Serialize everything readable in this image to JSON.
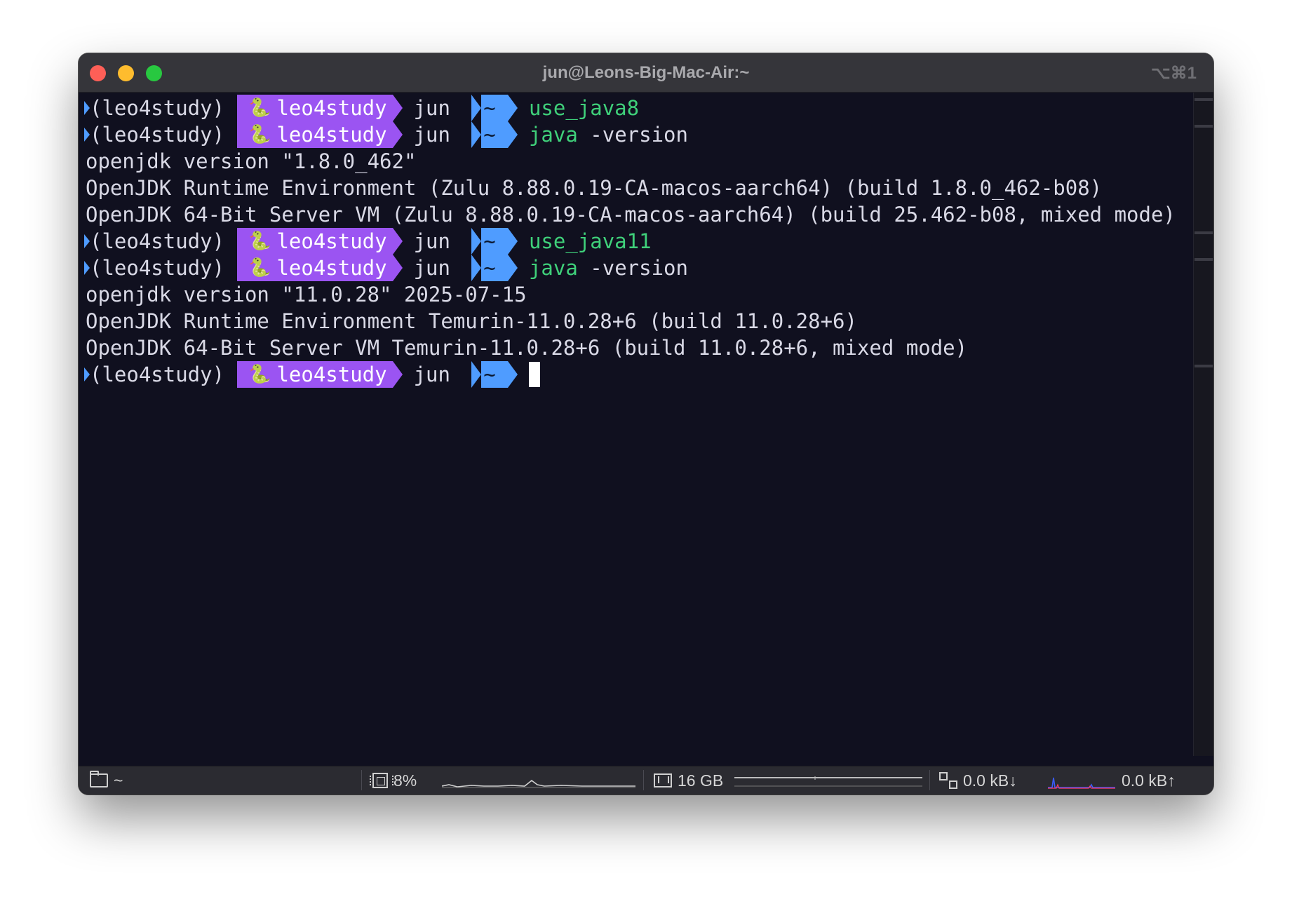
{
  "window": {
    "title": "jun@Leons-Big-Mac-Air:~",
    "shortcut": "⌥⌘1"
  },
  "prompt": {
    "env": "(leo4study)",
    "env_segment": "leo4study",
    "host": "jun",
    "dir": "~"
  },
  "terminal": {
    "lines": [
      {
        "type": "prompt",
        "cmd": "use_java8",
        "args": ""
      },
      {
        "type": "prompt",
        "cmd": "java",
        "args": " -version"
      },
      {
        "type": "output",
        "text": "openjdk version \"1.8.0_462\""
      },
      {
        "type": "output",
        "text": "OpenJDK Runtime Environment (Zulu 8.88.0.19-CA-macos-aarch64) (build 1.8.0_462-b08)"
      },
      {
        "type": "output",
        "text": "OpenJDK 64-Bit Server VM (Zulu 8.88.0.19-CA-macos-aarch64) (build 25.462-b08, mixed mode)"
      },
      {
        "type": "prompt",
        "cmd": "use_java11",
        "args": ""
      },
      {
        "type": "prompt",
        "cmd": "java",
        "args": " -version"
      },
      {
        "type": "output",
        "text": "openjdk version \"11.0.28\" 2025-07-15"
      },
      {
        "type": "output",
        "text": "OpenJDK Runtime Environment Temurin-11.0.28+6 (build 11.0.28+6)"
      },
      {
        "type": "output",
        "text": "OpenJDK 64-Bit Server VM Temurin-11.0.28+6 (build 11.0.28+6, mixed mode)"
      },
      {
        "type": "prompt_cursor",
        "cmd": "",
        "args": ""
      }
    ]
  },
  "statusbar": {
    "dir": "~",
    "cpu": "8%",
    "memory": "16 GB",
    "net_down": "0.0 kB↓",
    "net_up": "0.0 kB↑"
  },
  "colors": {
    "terminal_bg": "#10101f",
    "user_segment": "#9b54f2",
    "dir_segment": "#4f9cff",
    "command": "#3fd07a",
    "text": "#d9d9e6"
  },
  "icons": {
    "prompt_mark": "prompt-mark-icon",
    "env_snake": "python-snake-icon",
    "status_folder": "folder-icon",
    "status_cpu": "cpu-icon",
    "status_memory": "memory-icon",
    "status_network": "network-icon"
  }
}
